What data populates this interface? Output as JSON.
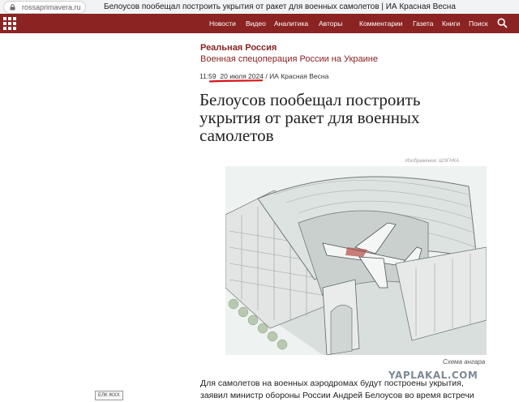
{
  "browser": {
    "url": "rossaprimavera.ru",
    "tab_title": "Белоусов пообещал построить укрытия от ракет для военных самолетов | ИА Красная Весна"
  },
  "site": {
    "logo_text": "",
    "nav": [
      "Новости",
      "Видео",
      "Аналитика",
      "Авторы",
      "Комментарии",
      "Газета",
      "Книги",
      "Поиск"
    ]
  },
  "article": {
    "section": "Реальная Россия",
    "subsection": "Военная спецоперация России на Украине",
    "time": "11:59",
    "date": "20 июля 2024",
    "source": "/ ИА Красная Весна",
    "headline": "Белоусов пообещал построить укрытия от ракет для военных самолетов",
    "image_credit": "Изображение: ШЭГНКА",
    "image_caption": "Схема ангара",
    "body_line1": "Для самолетов на военных аэродромах будут построены укрытия,",
    "body_line2": "заявил министр обороны России Андрей Белоусов во время встречи"
  },
  "overlay": {
    "watermark": "YAPLAKAL.COM",
    "tag": "ЕЛК ЖХХ"
  },
  "colors": {
    "brand": "#8a2322",
    "annotation": "#d8141a"
  },
  "icons": [
    "lock-icon",
    "menu-grid-icon",
    "search-icon"
  ]
}
